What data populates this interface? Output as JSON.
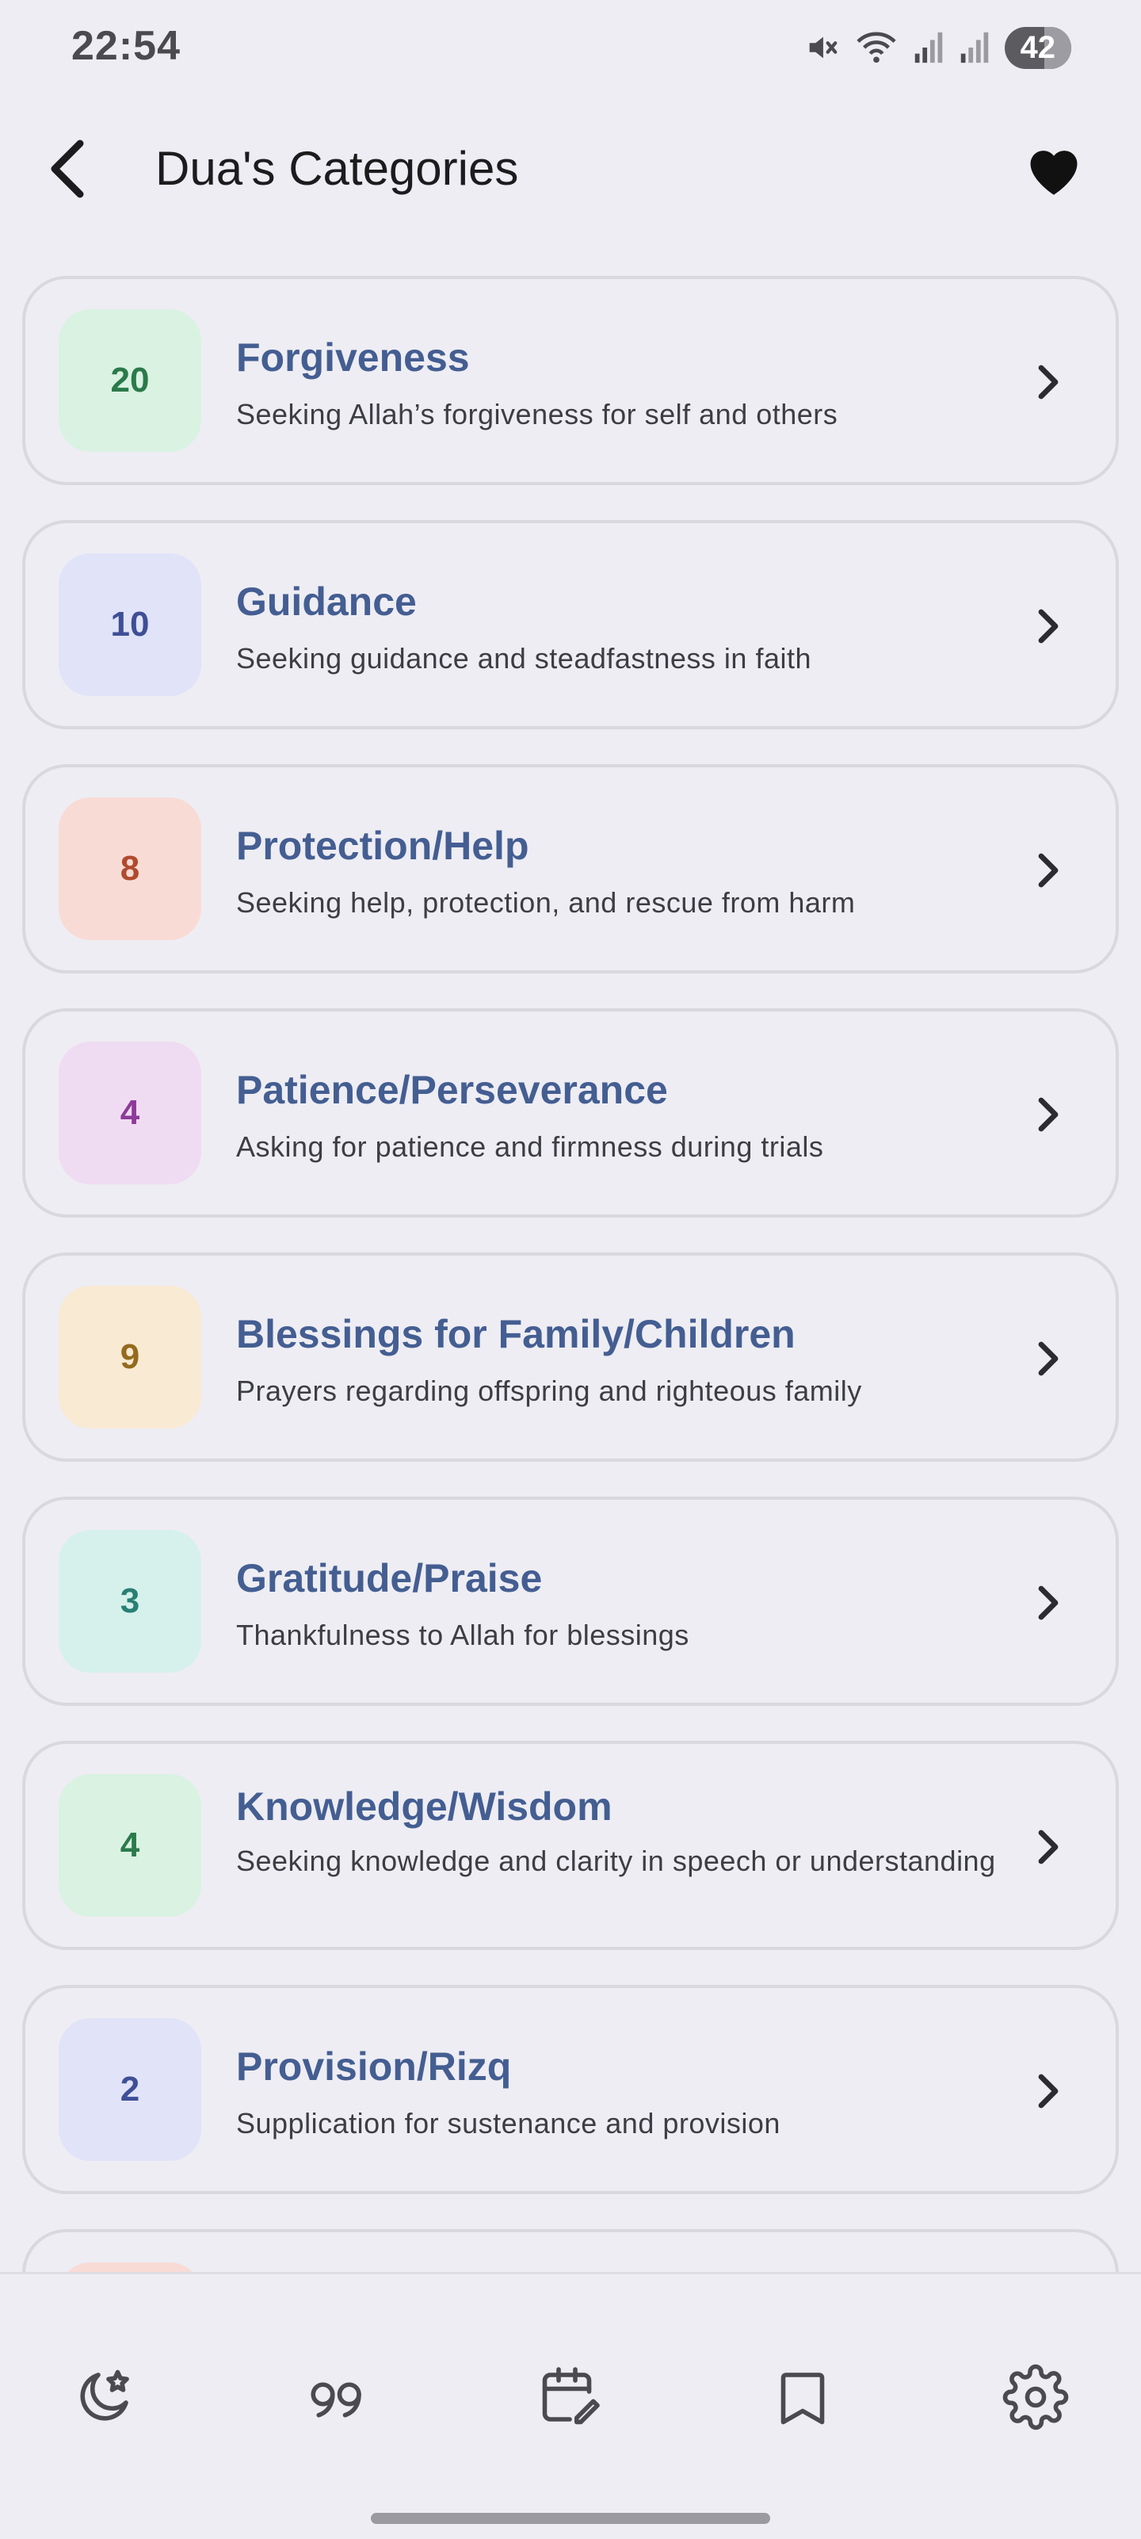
{
  "status_bar": {
    "time": "22:54",
    "battery": "42"
  },
  "app_bar": {
    "title": "Dua's Categories"
  },
  "categories": [
    {
      "count": "20",
      "title": "Forgiveness",
      "description": "Seeking Allah’s forgiveness for self and others",
      "badge_bg": "#daf2e2",
      "badge_fg": "#2a7a4a"
    },
    {
      "count": "10",
      "title": "Guidance",
      "description": "Seeking guidance and steadfastness in faith",
      "badge_bg": "#e1e3f8",
      "badge_fg": "#3f4f96"
    },
    {
      "count": "8",
      "title": "Protection/Help",
      "description": "Seeking help, protection, and rescue from harm",
      "badge_bg": "#f9dbd6",
      "badge_fg": "#b04a2e"
    },
    {
      "count": "4",
      "title": "Patience/Perseverance",
      "description": "Asking for patience and firmness during trials",
      "badge_bg": "#f0dcf2",
      "badge_fg": "#8e3a9a"
    },
    {
      "count": "9",
      "title": "Blessings for Family/Children",
      "description": "Prayers regarding offspring and righteous family",
      "badge_bg": "#f8ead3",
      "badge_fg": "#946a1e"
    },
    {
      "count": "3",
      "title": "Gratitude/Praise",
      "description": "Thankfulness to Allah for blessings",
      "badge_bg": "#d6f1ec",
      "badge_fg": "#2a7f74"
    },
    {
      "count": "4",
      "title": "Knowledge/Wisdom",
      "description": "Seeking knowledge and clarity in speech or understanding",
      "badge_bg": "#daf2e2",
      "badge_fg": "#2a7a4a"
    },
    {
      "count": "2",
      "title": "Provision/Rizq",
      "description": "Supplication for sustenance and provision",
      "badge_bg": "#e1e3f8",
      "badge_fg": "#3f4f96"
    },
    {
      "count": "",
      "title": "",
      "description": "",
      "badge_bg": "#f9dbd6",
      "badge_fg": "#b04a2e"
    }
  ],
  "bottom_nav": {
    "icons": [
      "moon-star-icon",
      "quote-icon",
      "calendar-edit-icon",
      "bookmark-icon",
      "settings-gear-icon"
    ]
  }
}
